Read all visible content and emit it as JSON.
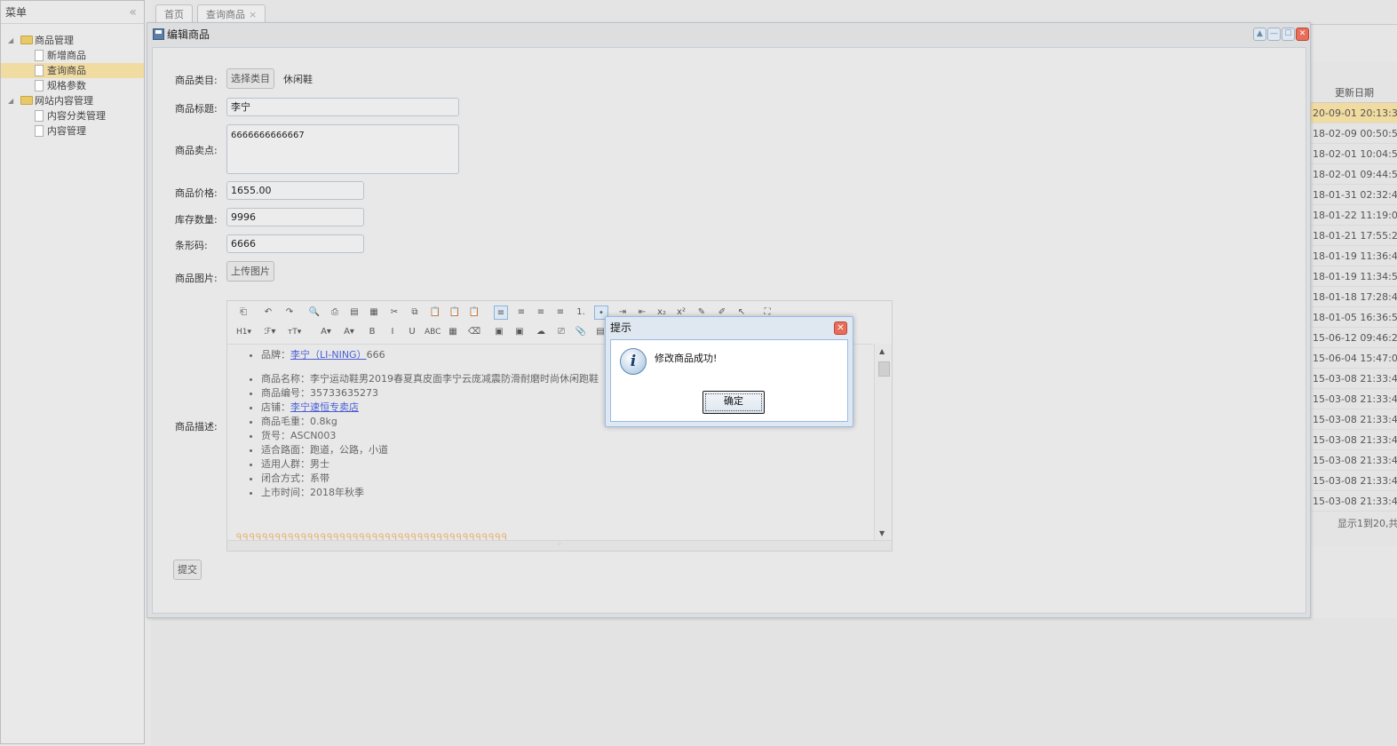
{
  "menu": {
    "title": "菜单",
    "collapse_icon": "«",
    "groups": [
      {
        "label": "商品管理",
        "items": [
          "新增商品",
          "查询商品",
          "规格参数"
        ],
        "selected": "查询商品"
      },
      {
        "label": "网站内容管理",
        "items": [
          "内容分类管理",
          "内容管理"
        ]
      }
    ]
  },
  "tabs": [
    {
      "label": "首页",
      "closable": false
    },
    {
      "label": "查询商品",
      "closable": true,
      "close_icon": "×"
    }
  ],
  "grid": {
    "header": "更新日期",
    "rows": [
      "20-09-01 20:13:3",
      "18-02-09 00:50:5",
      "18-02-01 10:04:5",
      "18-02-01 09:44:5",
      "18-01-31 02:32:4",
      "18-01-22 11:19:0",
      "18-01-21 17:55:2",
      "18-01-19 11:36:4",
      "18-01-19 11:34:5",
      "18-01-18 17:28:4",
      "18-01-05 16:36:5",
      "15-06-12 09:46:2",
      "15-06-04 15:47:0",
      "15-03-08 21:33:4",
      "15-03-08 21:33:4",
      "15-03-08 21:33:4",
      "15-03-08 21:33:4",
      "15-03-08 21:33:4",
      "15-03-08 21:33:4",
      "15-03-08 21:33:4"
    ],
    "footer": "显示1到20,共"
  },
  "edit_window": {
    "title": "编辑商品",
    "labels": {
      "category": "商品类目:",
      "title": "商品标题:",
      "sell_point": "商品卖点:",
      "price": "商品价格:",
      "stock": "库存数量:",
      "barcode": "条形码:",
      "image": "商品图片:",
      "desc": "商品描述:"
    },
    "category_button": "选择类目",
    "category_value": "休闲鞋",
    "title_value": "李宁",
    "sell_point_value": "6666666666667",
    "price_value": "1655.00",
    "stock_value": "9996",
    "barcode_value": "6666",
    "upload_button": "上传图片",
    "submit_button": "提交",
    "editor": {
      "toolbar1": [
        "⎗",
        "↶",
        "↷",
        "🔍",
        "⎙",
        "▤",
        "▦",
        "✂",
        "⧉",
        "📋",
        "📋",
        "📋",
        "≡",
        "≡",
        "≡",
        "≡",
        "1.",
        "•",
        "⇥",
        "⇤",
        "x₂",
        "x²",
        "✎",
        "✐",
        "↖",
        "⛶"
      ],
      "toolbar2": [
        "H1▾",
        "ℱ▾",
        "тT▾",
        "A▾",
        "A▾",
        "B",
        "I",
        "U",
        "ABC",
        "▦",
        "⌫",
        "▣",
        "▣",
        "☁",
        "⎚",
        "📎",
        "▤"
      ],
      "content": {
        "brand_label": "品牌：",
        "brand_link": "李宁（LI-NING）",
        "brand_suffix": "666",
        "name": "商品名称：李宁运动鞋男2019春夏真皮面李宁云庞减震防滑耐磨时尚休闲跑鞋",
        "code": "商品编号：35733635273",
        "store_label": "店铺：",
        "store_link": "李宁速恒专卖店",
        "weight": "商品毛重：0.8kg",
        "item_no": "货号：ASCN003",
        "road": "适合路面：跑道，公路，小道",
        "crowd": "适用人群：男士",
        "closure": "闭合方式：系带",
        "launch": "上市时间：2018年秋季"
      }
    },
    "window_buttons": [
      "▲",
      "—",
      "☐",
      "✕"
    ]
  },
  "alert": {
    "title": "提示",
    "message": "修改商品成功!",
    "ok_button": "确定",
    "close_icon": "✕",
    "info_icon": "i"
  }
}
